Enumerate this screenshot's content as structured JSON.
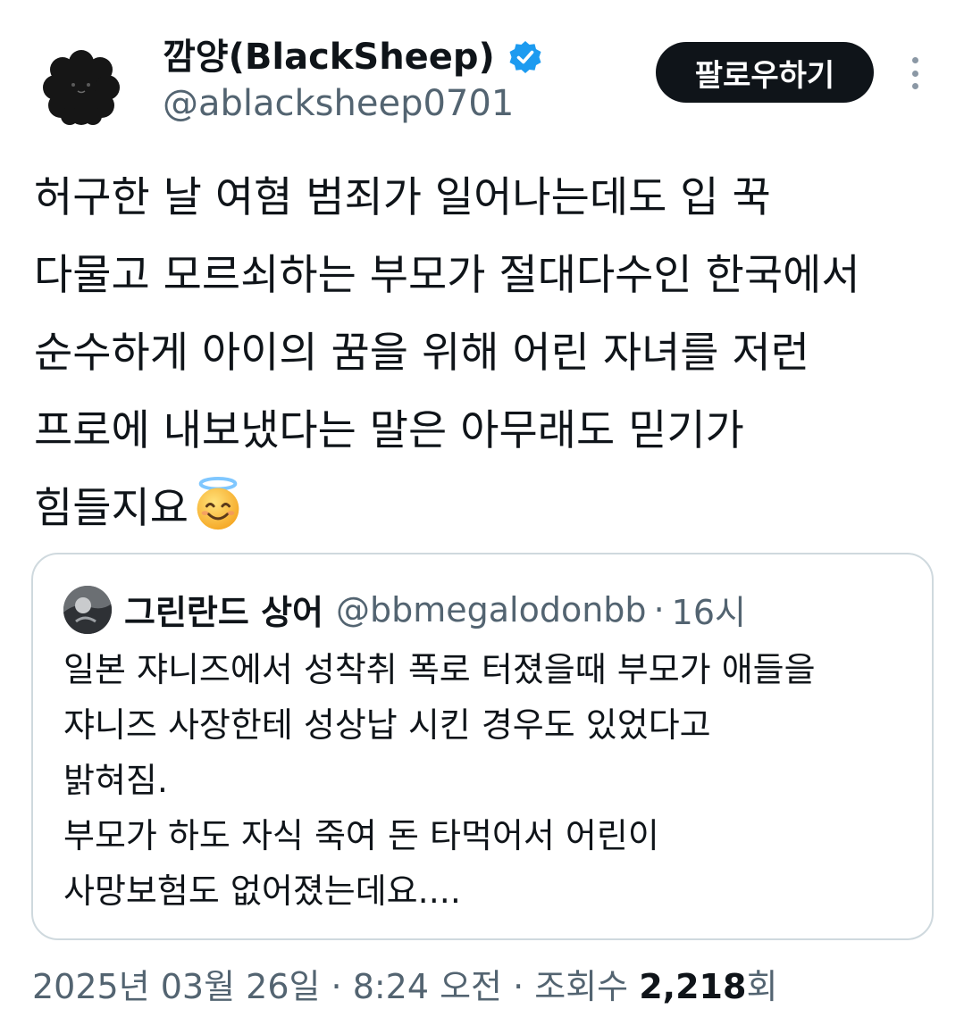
{
  "author": {
    "display_name": "깜양(BlackSheep)",
    "handle": "@ablacksheep0701",
    "verified": true,
    "avatar_icon": "black-sheep-avatar"
  },
  "follow_button": {
    "label": "팔로우하기"
  },
  "more_button": {
    "icon": "more-vertical-icon"
  },
  "tweet": {
    "lines": [
      "허구한 날 여혐 범죄가 일어나는데도 입 꾹",
      "다물고 모르쇠하는 부모가 절대다수인 한국에서",
      "순수하게 아이의 꿈을 위해 어린 자녀를 저런",
      "프로에 내보냈다는 말은 아무래도 믿기가",
      "힘들지요"
    ],
    "emoji": "smiling-face-with-halo"
  },
  "quote": {
    "display_name": "그린란드 상어",
    "handle": "@bbmegalodonbb",
    "separator": "·",
    "time": "16시",
    "lines": [
      "일본 쟈니즈에서 성착취 폭로 터졌을때 부모가 애들을",
      "쟈니즈 사장한테 성상납 시킨 경우도 있었다고",
      "밝혀짐.",
      "부모가 하도 자식 죽여 돈 타먹어서 어린이",
      "사망보험도 없어졌는데요...."
    ]
  },
  "meta": {
    "date_time": "2025년 03월 26일 · 8:24 오전 · 조회수 ",
    "views": "2,218",
    "views_suffix": "회"
  },
  "colors": {
    "text": "#0f1419",
    "secondary": "#536471",
    "verified_blue": "#1d9bf0",
    "border": "#cfd9de",
    "button_bg": "#0f1419"
  }
}
